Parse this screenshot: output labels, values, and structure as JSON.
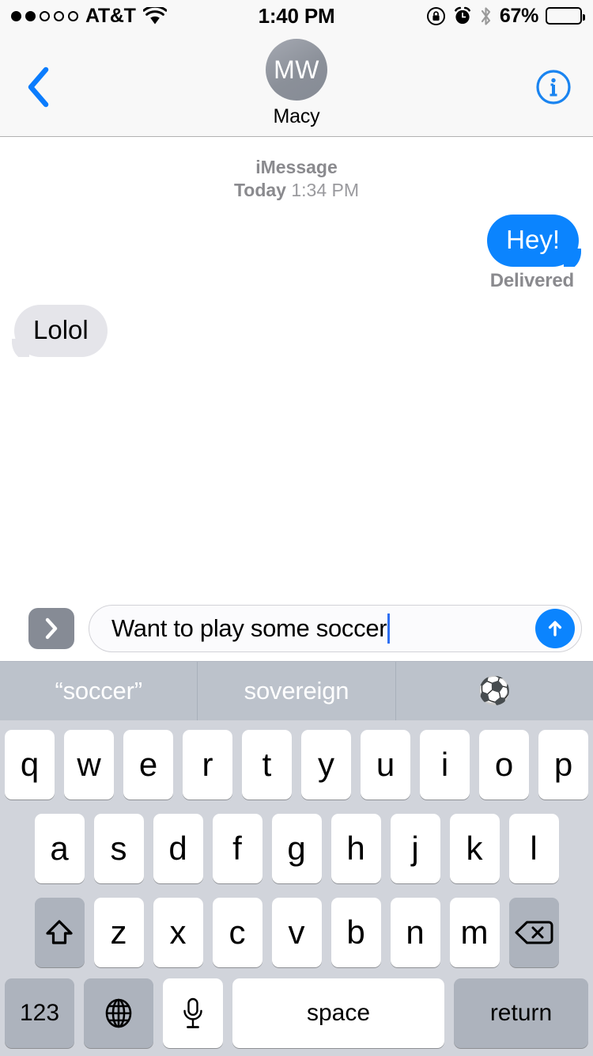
{
  "status_bar": {
    "carrier": "AT&T",
    "signal_dots_filled": 2,
    "signal_dots_total": 5,
    "wifi_icon": "wifi-icon",
    "time": "1:40 PM",
    "rotation_lock_icon": "rotation-lock-icon",
    "alarm_icon": "alarm-clock-icon",
    "bluetooth_icon": "bluetooth-icon",
    "battery_percent": "67%",
    "battery_level": 67
  },
  "nav_bar": {
    "back_icon": "chevron-left-icon",
    "info_icon": "info-circle-icon",
    "contact": {
      "initials": "MW",
      "name": "Macy"
    }
  },
  "thread": {
    "service": "iMessage",
    "day": "Today",
    "time": "1:34 PM",
    "messages": [
      {
        "text": "Hey!",
        "direction": "outgoing",
        "status": "Delivered"
      },
      {
        "text": "Lolol",
        "direction": "incoming",
        "status": ""
      }
    ]
  },
  "input_bar": {
    "expand_icon": "chevron-right-icon",
    "draft_text": "Want to play some soccer",
    "placeholder": "iMessage",
    "send_icon": "arrow-up-icon"
  },
  "predictive_bar": {
    "suggestions": [
      {
        "label": "“soccer”",
        "type": "text"
      },
      {
        "label": "sovereign",
        "type": "text"
      },
      {
        "label": "⚽",
        "type": "emoji"
      }
    ]
  },
  "keyboard": {
    "row1": [
      "q",
      "w",
      "e",
      "r",
      "t",
      "y",
      "u",
      "i",
      "o",
      "p"
    ],
    "row2": [
      "a",
      "s",
      "d",
      "f",
      "g",
      "h",
      "j",
      "k",
      "l"
    ],
    "row3": [
      "z",
      "x",
      "c",
      "v",
      "b",
      "n",
      "m"
    ],
    "shift_icon": "shift-arrow-icon",
    "delete_icon": "backspace-icon",
    "numbers_label": "123",
    "globe_icon": "globe-icon",
    "mic_icon": "microphone-icon",
    "space_label": "space",
    "return_label": "return"
  },
  "colors": {
    "outgoing_bubble": "#0b84fe",
    "incoming_bubble": "#e5e5ea",
    "accent_blue": "#0b84fe",
    "keyboard_bg": "#d1d4db",
    "predictive_bg": "#bcc2cb",
    "header_bg": "#f8f8f8"
  }
}
